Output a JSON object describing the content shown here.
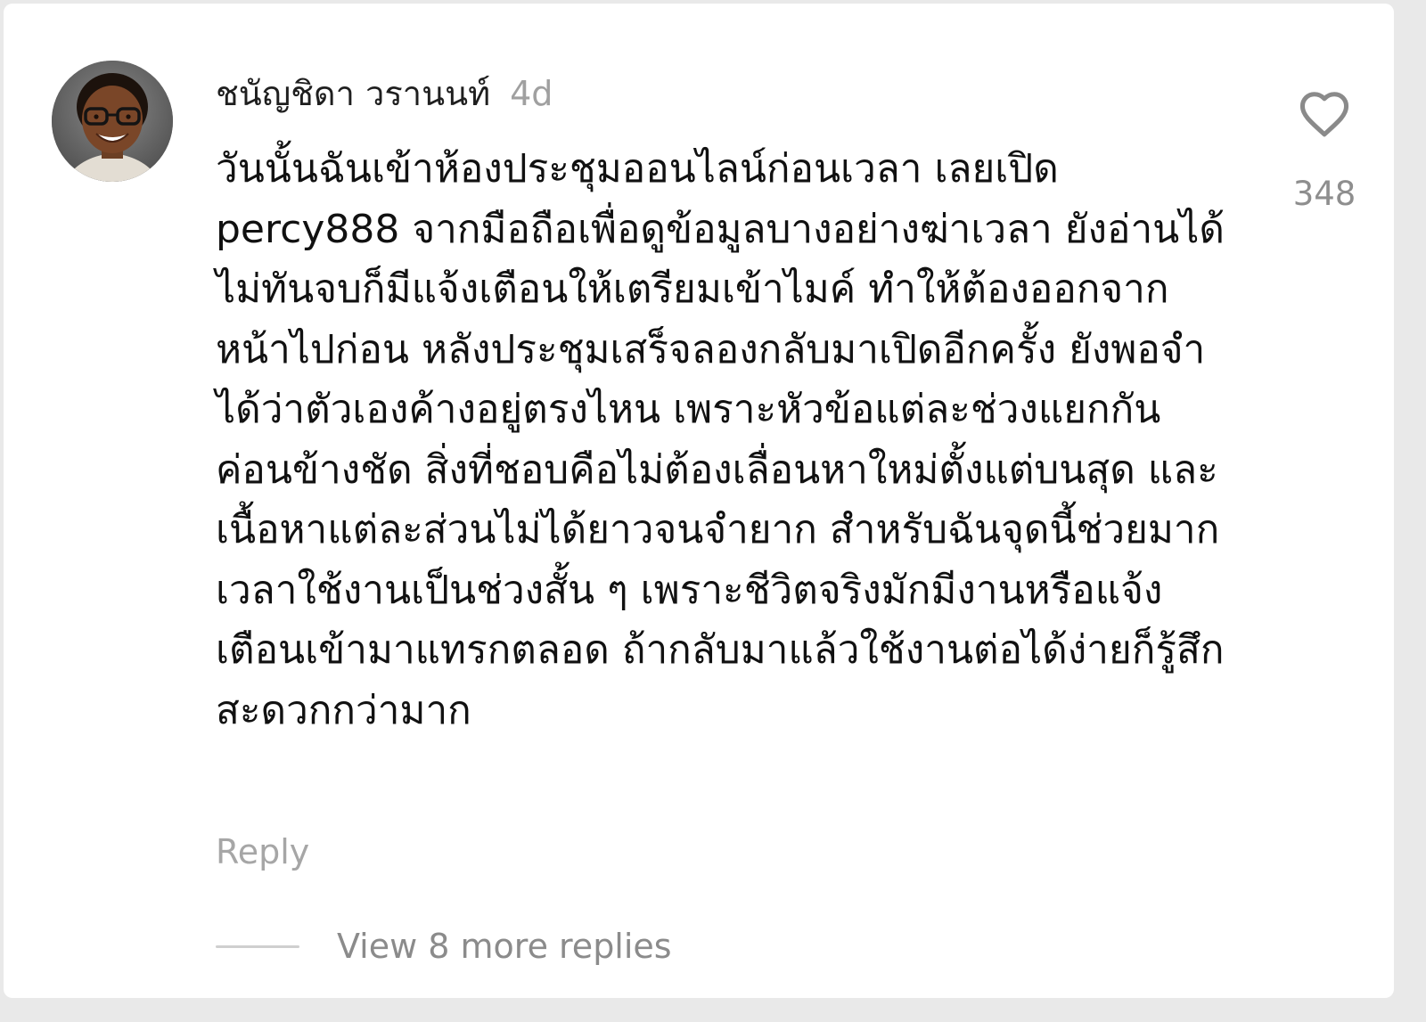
{
  "comment": {
    "username": "ชนัญชิดา วรานนท์",
    "timestamp": "4d",
    "text": "วันนั้นฉันเข้าห้องประชุมออนไลน์ก่อนเวลา เลยเปิด percy888 จากมือถือเพื่อดูข้อมูลบางอย่างฆ่าเวลา ยังอ่านได้ไม่ทันจบก็มีแจ้งเตือนให้เตรียมเข้าไมค์ ทำให้ต้องออกจากหน้าไปก่อน หลังประชุมเสร็จลองกลับมาเปิดอีกครั้ง ยังพอจำได้ว่าตัวเองค้างอยู่ตรงไหน เพราะหัวข้อแต่ละช่วงแยกกันค่อนข้างชัด สิ่งที่ชอบคือไม่ต้องเลื่อนหาใหม่ตั้งแต่บนสุด และเนื้อหาแต่ละส่วนไม่ได้ยาวจนจำยาก สำหรับฉันจุดนี้ช่วยมากเวลาใช้งานเป็นช่วงสั้น ๆ เพราะชีวิตจริงมักมีงานหรือแจ้งเตือนเข้ามาแทรกตลอด ถ้ากลับมาแล้วใช้งานต่อได้ง่ายก็รู้สึกสะดวกกว่ามาก",
    "reply_label": "Reply",
    "view_replies_label": "View 8 more replies",
    "like_count": "348",
    "like_icon": "heart-outline-icon"
  },
  "colors": {
    "card_background": "#ffffff",
    "page_background": "#e9e9e9",
    "text_primary": "#111111",
    "text_muted": "#a0a0a0",
    "heart_outline": "#8a8a8a"
  }
}
